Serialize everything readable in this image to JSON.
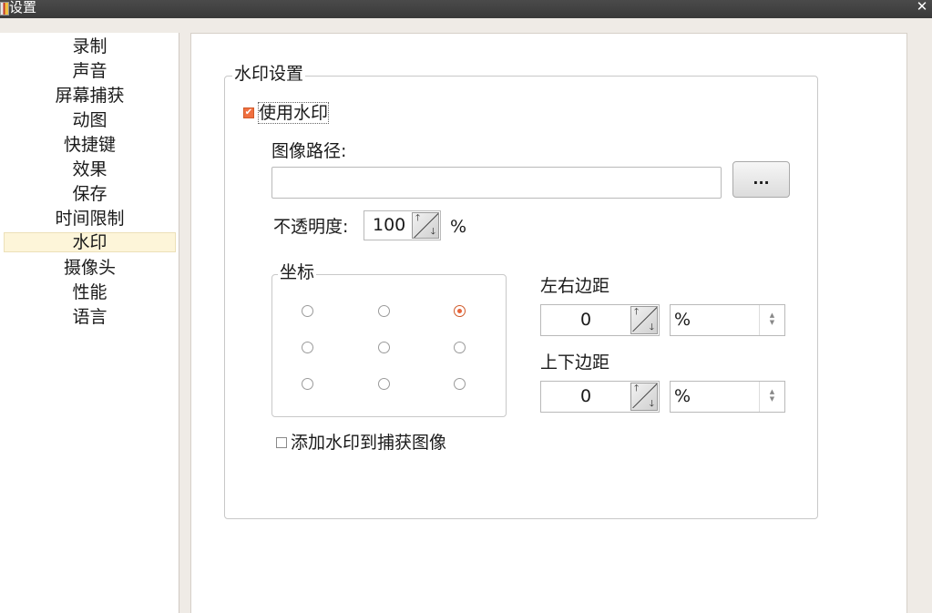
{
  "window": {
    "title": "设置",
    "close_glyph": "✕"
  },
  "sidebar": {
    "items": [
      {
        "label": "录制"
      },
      {
        "label": "声音"
      },
      {
        "label": "屏幕捕获"
      },
      {
        "label": "动图"
      },
      {
        "label": "快捷键"
      },
      {
        "label": "效果"
      },
      {
        "label": "保存"
      },
      {
        "label": "时间限制"
      },
      {
        "label": "水印",
        "selected": true
      },
      {
        "label": "摄像头"
      },
      {
        "label": "性能"
      },
      {
        "label": "语言"
      }
    ]
  },
  "watermark": {
    "group_title": "水印设置",
    "use_watermark": {
      "label": "使用水印",
      "checked": true,
      "check_glyph": "✔"
    },
    "image_path": {
      "label": "图像路径:",
      "value": "",
      "browse_label": "..."
    },
    "opacity": {
      "label": "不透明度:",
      "value": "100",
      "unit": "%"
    },
    "coordinates": {
      "group_title": "坐标",
      "selected_index": 2,
      "positions": [
        "top-left",
        "top-center",
        "top-right",
        "middle-left",
        "center",
        "middle-right",
        "bottom-left",
        "bottom-center",
        "bottom-right"
      ]
    },
    "horizontal_margin": {
      "label": "左右边距",
      "value": "0",
      "unit": "%"
    },
    "vertical_margin": {
      "label": "上下边距",
      "value": "0",
      "unit": "%"
    },
    "add_to_capture": {
      "label": "添加水印到捕获图像",
      "checked": false
    }
  },
  "icons": {
    "spin_up": "🡑",
    "spin_down": "🡓",
    "combo_up": "▲",
    "combo_down": "▼"
  },
  "colors": {
    "accent": "#e8643a",
    "selected_bg": "#fdf5d9",
    "titlebar": "#3a3a3a"
  }
}
